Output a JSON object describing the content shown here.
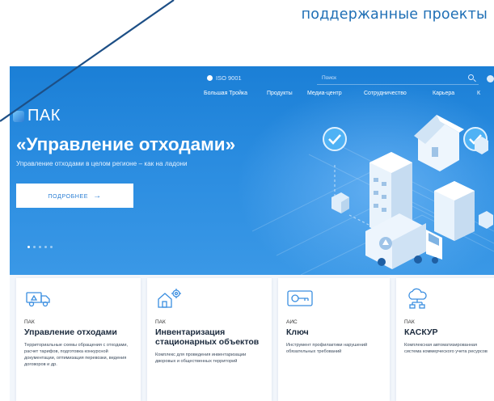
{
  "caption": "поддержанные проекты",
  "nav": {
    "iso": "ISO 9001",
    "search_placeholder": "Поиск",
    "links": [
      "Большая Тройка",
      "Продукты",
      "Медиа-центр",
      "Сотрудничество",
      "Карьера",
      "К"
    ]
  },
  "hero": {
    "logo_text": "ПАК",
    "title": "«Управление отходами»",
    "subtitle": "Управление отходами в целом регионе – как на ладони",
    "button_label": "ПОДРОБНЕЕ",
    "button_arrow": "→",
    "slide_count": 5,
    "active_slide": 1
  },
  "cards": [
    {
      "icon": "garbage-truck-icon",
      "type": "ПАК",
      "name": "Управление отходами",
      "desc": "Территориальные схемы обращения с отходами, расчет тарифов, подготовка конкурсной документации, оптимизация перевозки, ведения договоров и др."
    },
    {
      "icon": "house-gear-icon",
      "type": "ПАК",
      "name": "Инвентаризация стационарных объектов",
      "desc": "Комплекс для проведения инвентаризации дворовых и общественных территорий"
    },
    {
      "icon": "key-card-icon",
      "type": "АИС",
      "name": "Ключ",
      "desc": "Инструмент профилактики нарушений обязательных требований"
    },
    {
      "icon": "cloud-server-icon",
      "type": "ПАК",
      "name": "КАСКУР",
      "desc": "Комплексная автоматизированная система коммерческого учета ресурсов"
    }
  ],
  "colors": {
    "hero_top": "#1b7fd6",
    "hero_bottom": "#3a98e6",
    "accent": "#2c7fd4",
    "caption": "#1f6fb5"
  }
}
